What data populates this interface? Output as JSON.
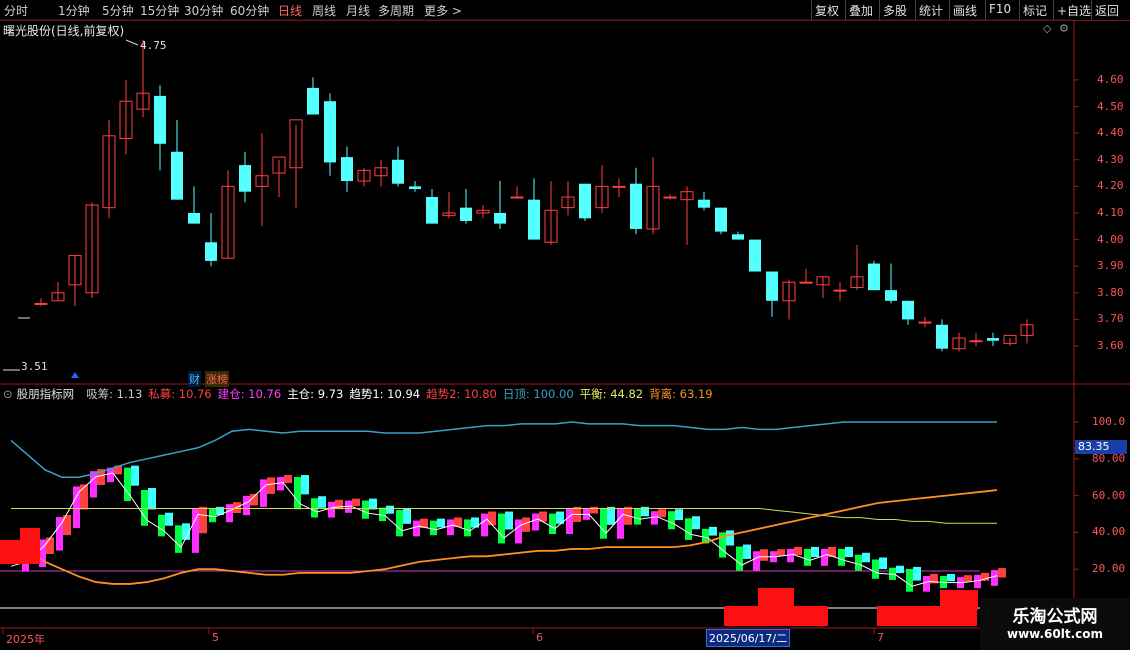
{
  "toolbar": {
    "periods": [
      "分时",
      "1分钟",
      "5分钟",
      "15分钟",
      "30分钟",
      "60分钟",
      "日线",
      "周线",
      "月线",
      "多周期",
      "更多"
    ],
    "active_period": "日线",
    "right_buttons": [
      "复权",
      "叠加",
      "多股",
      "统计",
      "画线",
      "F10",
      "标记",
      "+自选",
      "返回"
    ]
  },
  "price_panel": {
    "title": "曙光股份(日线,前复权)",
    "high_marker": "4.75",
    "low_marker": "3.51",
    "axis_labels": [
      "4.60",
      "4.50",
      "4.40",
      "4.30",
      "4.20",
      "4.10",
      "4.00",
      "3.90",
      "3.80",
      "3.70",
      "3.60"
    ],
    "tags": [
      {
        "text": "财",
        "color": "#4fb2ff"
      },
      {
        "text": "涨榜",
        "color": "#ff6060"
      }
    ]
  },
  "indicator_panel": {
    "name": "股朋指标网",
    "values": [
      {
        "label": "吸筹",
        "value": "1.13",
        "color": "#c8c8c8"
      },
      {
        "label": "私募",
        "value": "10.76",
        "color": "#ff4040"
      },
      {
        "label": "建仓",
        "value": "10.76",
        "color": "#ff40ff"
      },
      {
        "label": "主仓",
        "value": "9.73",
        "color": "#ffffff"
      },
      {
        "label": "趋势1",
        "value": "10.94",
        "color": "#ffffff"
      },
      {
        "label": "趋势2",
        "value": "10.80",
        "color": "#ff4040"
      },
      {
        "label": "日顶",
        "value": "100.00",
        "color": "#3aa0c8"
      },
      {
        "label": "平衡",
        "value": "44.82",
        "color": "#e8e860"
      },
      {
        "label": "背离",
        "value": "63.19",
        "color": "#ff9020"
      }
    ],
    "axis_labels": [
      "100.0",
      "80.00",
      "60.00",
      "40.00",
      "20.00"
    ],
    "current_value_tag": "83.35"
  },
  "x_axis": {
    "labels": [
      "2025年",
      "5",
      "6",
      "7"
    ],
    "selected_date": "2025/06/17/二"
  },
  "watermark": {
    "line1": "乐淘公式网",
    "line2": "www.60lt.com"
  },
  "colors": {
    "up": "#ff4040",
    "down": "#54ffff",
    "axis": "#a01818",
    "grid_text": "#ff5555"
  },
  "chart_data": {
    "type": "candlestick",
    "candles": [
      {
        "o": 3.76,
        "h": 3.78,
        "l": 3.75,
        "c": 3.76
      },
      {
        "o": 3.77,
        "h": 3.84,
        "l": 3.77,
        "c": 3.8
      },
      {
        "o": 3.83,
        "h": 3.94,
        "l": 3.75,
        "c": 3.94
      },
      {
        "o": 3.8,
        "h": 4.14,
        "l": 3.78,
        "c": 4.13
      },
      {
        "o": 4.12,
        "h": 4.45,
        "l": 4.08,
        "c": 4.39
      },
      {
        "o": 4.38,
        "h": 4.6,
        "l": 4.32,
        "c": 4.52
      },
      {
        "o": 4.49,
        "h": 4.75,
        "l": 4.46,
        "c": 4.55
      },
      {
        "o": 4.54,
        "h": 4.58,
        "l": 4.26,
        "c": 4.36
      },
      {
        "o": 4.33,
        "h": 4.45,
        "l": 4.15,
        "c": 4.15
      },
      {
        "o": 4.1,
        "h": 4.2,
        "l": 4.06,
        "c": 4.06
      },
      {
        "o": 3.99,
        "h": 4.1,
        "l": 3.9,
        "c": 3.92
      },
      {
        "o": 3.93,
        "h": 4.26,
        "l": 3.93,
        "c": 4.2
      },
      {
        "o": 4.28,
        "h": 4.33,
        "l": 4.14,
        "c": 4.18
      },
      {
        "o": 4.2,
        "h": 4.4,
        "l": 4.05,
        "c": 4.24
      },
      {
        "o": 4.25,
        "h": 4.3,
        "l": 4.16,
        "c": 4.31
      },
      {
        "o": 4.27,
        "h": 4.43,
        "l": 4.12,
        "c": 4.45
      },
      {
        "o": 4.57,
        "h": 4.61,
        "l": 4.48,
        "c": 4.47
      },
      {
        "o": 4.52,
        "h": 4.55,
        "l": 4.24,
        "c": 4.29
      },
      {
        "o": 4.31,
        "h": 4.35,
        "l": 4.18,
        "c": 4.22
      },
      {
        "o": 4.22,
        "h": 4.27,
        "l": 4.2,
        "c": 4.26
      },
      {
        "o": 4.24,
        "h": 4.3,
        "l": 4.2,
        "c": 4.27
      },
      {
        "o": 4.3,
        "h": 4.35,
        "l": 4.2,
        "c": 4.21
      },
      {
        "o": 4.2,
        "h": 4.22,
        "l": 4.18,
        "c": 4.19
      },
      {
        "o": 4.16,
        "h": 4.19,
        "l": 4.06,
        "c": 4.06
      },
      {
        "o": 4.09,
        "h": 4.18,
        "l": 4.08,
        "c": 4.1
      },
      {
        "o": 4.12,
        "h": 4.19,
        "l": 4.06,
        "c": 4.07
      },
      {
        "o": 4.1,
        "h": 4.13,
        "l": 4.08,
        "c": 4.11
      },
      {
        "o": 4.1,
        "h": 4.22,
        "l": 4.04,
        "c": 4.06
      },
      {
        "o": 4.16,
        "h": 4.2,
        "l": 4.16,
        "c": 4.16
      },
      {
        "o": 4.15,
        "h": 4.23,
        "l": 4.0,
        "c": 4.0
      },
      {
        "o": 3.99,
        "h": 4.22,
        "l": 3.98,
        "c": 4.11
      },
      {
        "o": 4.12,
        "h": 4.22,
        "l": 4.09,
        "c": 4.16
      },
      {
        "o": 4.21,
        "h": 4.21,
        "l": 4.07,
        "c": 4.08
      },
      {
        "o": 4.12,
        "h": 4.28,
        "l": 4.1,
        "c": 4.2
      },
      {
        "o": 4.2,
        "h": 4.23,
        "l": 4.16,
        "c": 4.2
      },
      {
        "o": 4.21,
        "h": 4.27,
        "l": 4.02,
        "c": 4.04
      },
      {
        "o": 4.04,
        "h": 4.31,
        "l": 4.02,
        "c": 4.2
      },
      {
        "o": 4.16,
        "h": 4.17,
        "l": 4.15,
        "c": 4.16
      },
      {
        "o": 4.15,
        "h": 4.2,
        "l": 3.98,
        "c": 4.18
      },
      {
        "o": 4.15,
        "h": 4.18,
        "l": 4.11,
        "c": 4.12
      },
      {
        "o": 4.12,
        "h": 4.12,
        "l": 4.02,
        "c": 4.03
      },
      {
        "o": 4.02,
        "h": 4.03,
        "l": 4.0,
        "c": 4.0
      },
      {
        "o": 4.0,
        "h": 4.0,
        "l": 3.88,
        "c": 3.88
      },
      {
        "o": 3.88,
        "h": 3.88,
        "l": 3.71,
        "c": 3.77
      },
      {
        "o": 3.77,
        "h": 3.85,
        "l": 3.7,
        "c": 3.84
      },
      {
        "o": 3.84,
        "h": 3.89,
        "l": 3.84,
        "c": 3.84
      },
      {
        "o": 3.83,
        "h": 3.86,
        "l": 3.78,
        "c": 3.86
      },
      {
        "o": 3.81,
        "h": 3.84,
        "l": 3.77,
        "c": 3.81
      },
      {
        "o": 3.82,
        "h": 3.98,
        "l": 3.81,
        "c": 3.86
      },
      {
        "o": 3.91,
        "h": 3.92,
        "l": 3.81,
        "c": 3.81
      },
      {
        "o": 3.81,
        "h": 3.91,
        "l": 3.76,
        "c": 3.77
      },
      {
        "o": 3.77,
        "h": 3.77,
        "l": 3.68,
        "c": 3.7
      },
      {
        "o": 3.69,
        "h": 3.71,
        "l": 3.67,
        "c": 3.69
      },
      {
        "o": 3.68,
        "h": 3.7,
        "l": 3.58,
        "c": 3.59
      },
      {
        "o": 3.59,
        "h": 3.65,
        "l": 3.58,
        "c": 3.63
      },
      {
        "o": 3.62,
        "h": 3.65,
        "l": 3.6,
        "c": 3.62
      },
      {
        "o": 3.63,
        "h": 3.65,
        "l": 3.6,
        "c": 3.62
      },
      {
        "o": 3.61,
        "h": 3.63,
        "l": 3.6,
        "c": 3.64
      },
      {
        "o": 3.64,
        "h": 3.7,
        "l": 3.61,
        "c": 3.68
      }
    ],
    "ylim": [
      3.51,
      4.75
    ],
    "indicator": {
      "ylim": [
        0,
        105
      ],
      "ri_ding": [
        90,
        82,
        74,
        70,
        70,
        72,
        75,
        78,
        80,
        82,
        84,
        86,
        90,
        95,
        96,
        95,
        94,
        95,
        95,
        95,
        95,
        95,
        94,
        94,
        94,
        95,
        96,
        97,
        98,
        98,
        99,
        99,
        99,
        100,
        99,
        99,
        99,
        98,
        98,
        98,
        97,
        96,
        96,
        97,
        96,
        96,
        97,
        98,
        99,
        100,
        100,
        100,
        100,
        100,
        100,
        100,
        100,
        100,
        100
      ],
      "ping_heng": [
        53,
        53,
        53,
        53,
        53,
        53,
        53,
        53,
        53,
        53,
        53,
        53,
        53,
        53,
        53,
        53,
        53,
        53,
        53,
        53,
        53,
        53,
        53,
        53,
        53,
        53,
        53,
        53,
        53,
        53,
        53,
        53,
        53,
        53,
        53,
        53,
        53,
        53,
        53,
        53,
        53,
        53,
        53,
        53,
        53,
        52,
        51,
        50,
        49,
        48,
        48,
        47,
        47,
        46,
        46,
        45,
        45,
        45,
        45
      ],
      "bei_li": [
        35,
        30,
        24,
        20,
        16,
        13,
        12,
        12,
        13,
        15,
        18,
        20,
        20,
        19,
        18,
        17,
        17,
        18,
        18,
        18,
        18,
        19,
        20,
        22,
        24,
        25,
        26,
        27,
        27,
        28,
        29,
        30,
        30,
        31,
        31,
        32,
        32,
        32,
        32,
        32,
        33,
        35,
        38,
        40,
        42,
        44,
        46,
        48,
        50,
        52,
        54,
        56,
        57,
        58,
        59,
        60,
        61,
        62,
        63
      ]
    }
  }
}
